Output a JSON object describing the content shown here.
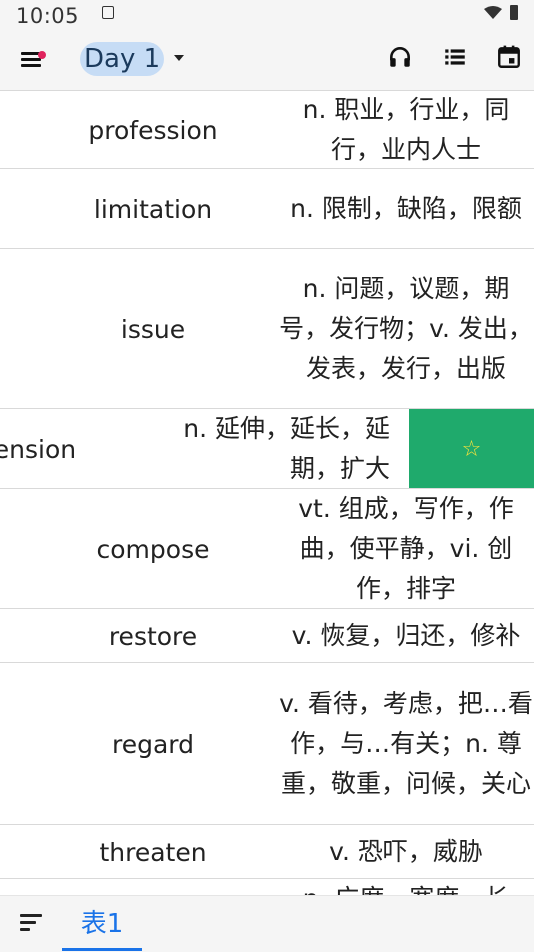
{
  "status_bar": {
    "time": "10:05"
  },
  "app_bar": {
    "title": "Day 1"
  },
  "rows": [
    {
      "word": "profession",
      "definition": "n. 职业，行业，同行，业内人士"
    },
    {
      "word": "limitation",
      "definition": "n. 限制，缺陷，限额"
    },
    {
      "word": "issue",
      "definition": "n. 问题，议题，期号，发行物；v. 发出，发表，发行，出版"
    },
    {
      "word": "tension",
      "definition": "n. 延伸，延长，延期，扩大",
      "action": "☆"
    },
    {
      "word": "compose",
      "definition": "vt. 组成，写作，作曲，使平静，vi. 创作，排字"
    },
    {
      "word": "restore",
      "definition": "v. 恢复，归还，修补"
    },
    {
      "word": "regard",
      "definition": "v. 看待，考虑，把…看作，与…有关；n. 尊重，敬重，问候，关心"
    },
    {
      "word": "threaten",
      "definition": "v. 恐吓，威胁"
    },
    {
      "word": "",
      "definition": "n. 广度，宽度，长"
    }
  ],
  "bottom_bar": {
    "sheet_tab": "表1"
  }
}
